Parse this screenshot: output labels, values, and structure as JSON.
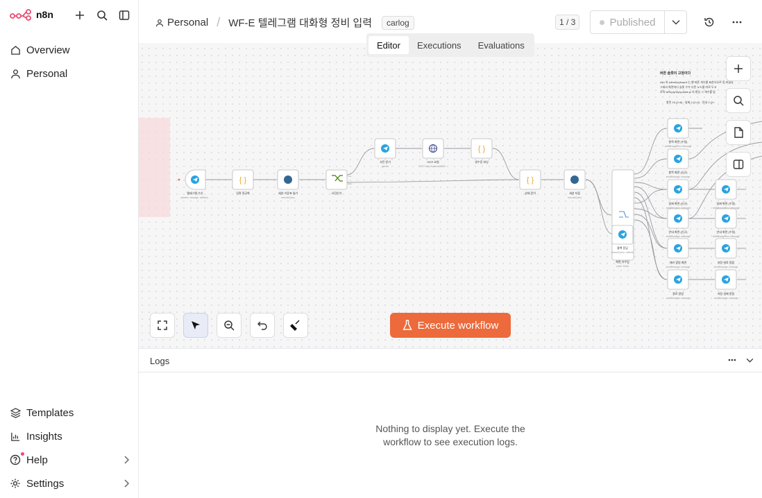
{
  "app": {
    "logo_text": "n8n"
  },
  "sidebar": {
    "top_items": [
      {
        "label": "Overview",
        "icon": "home-icon"
      },
      {
        "label": "Personal",
        "icon": "user-icon"
      }
    ],
    "bottom_items": [
      {
        "label": "Templates",
        "icon": "templates-icon"
      },
      {
        "label": "Insights",
        "icon": "insights-icon"
      },
      {
        "label": "Help",
        "icon": "help-icon"
      },
      {
        "label": "Settings",
        "icon": "settings-icon"
      }
    ]
  },
  "header": {
    "project": "Personal",
    "workflow_name": "WF-E 텔레그램 대화형 정비 입력",
    "tag": "carlog",
    "counter": "1 / 3",
    "publish_label": "Published"
  },
  "tabs": [
    {
      "label": "Editor",
      "active": true
    },
    {
      "label": "Executions",
      "active": false
    },
    {
      "label": "Evaluations",
      "active": false
    }
  ],
  "canvas": {
    "execute_label": "Execute workflow",
    "note_title": "버튼 슬롯이 고정이다",
    "note_line1": "n8n 의 inlineKeyboard 는 행 버튼 개수를 표현식으로 못 바꿈다.",
    "note_line2": "그래서 화면마다 슬롯 수가 다른 노드를 따로 두고",
    "note_line3": "로직 isReply/reply.state.js 의 항상 그 개수를 맞",
    "note_line4": "항목 16 (2×8) · 날짜 4 (2×2) · 안내 2 (2×",
    "nodes": {
      "n1": "텔레그램 수신",
      "n1s": "updates: message, callback...",
      "n2": "입력 정규화",
      "n3": "세션·기준표 읽기",
      "n3s": "executeQuery",
      "n4": "사진인가",
      "n5": "사진 받기",
      "n5s": "get: file",
      "n6": "OCR 요청",
      "n6s": "POST: http://localhost:8000...",
      "n7": "영수증 파싱",
      "n8": "상태 전이",
      "n9": "세션 저장",
      "n9s": "executeQuery",
      "n10": "화면 라우팅",
      "n10s": "mode: Rules",
      "n11": "콜백 응답",
      "n11s": "answerQuery: callback",
      "r1": "항목 화면 (수정)",
      "r1s": "editMessageText: message",
      "r2": "항목 화면 (신규)",
      "r2s": "sendMessage: message",
      "r3": "날짜 화면 (신규)",
      "r3s": "sendMessage: message",
      "r4": "안내 화면 (신규)",
      "r4s": "sendMessage: message",
      "r5": "에러 알림 화면",
      "r5s": "sendMessage: message",
      "r6": "종료 알림",
      "r6s": "sendMessage: message",
      "s1": "날짜 화면 (수정)",
      "s1s": "editMessageText: message",
      "s2": "안내 화면 (수정)",
      "s2s": "editMessageText: message",
      "s3": "저장 완료 알림",
      "s3s": "sendMessage: message",
      "s4": "저장 실패 알림",
      "s4s": "sendMessage: message",
      "out_true": "true",
      "out_false": "false"
    }
  },
  "logs": {
    "title": "Logs",
    "empty_text": "Nothing to display yet. Execute the workflow to see execution logs."
  },
  "colors": {
    "accent": "#ec6a3c",
    "brand": "#ea4b71",
    "telegram": "#2aa3e0"
  }
}
